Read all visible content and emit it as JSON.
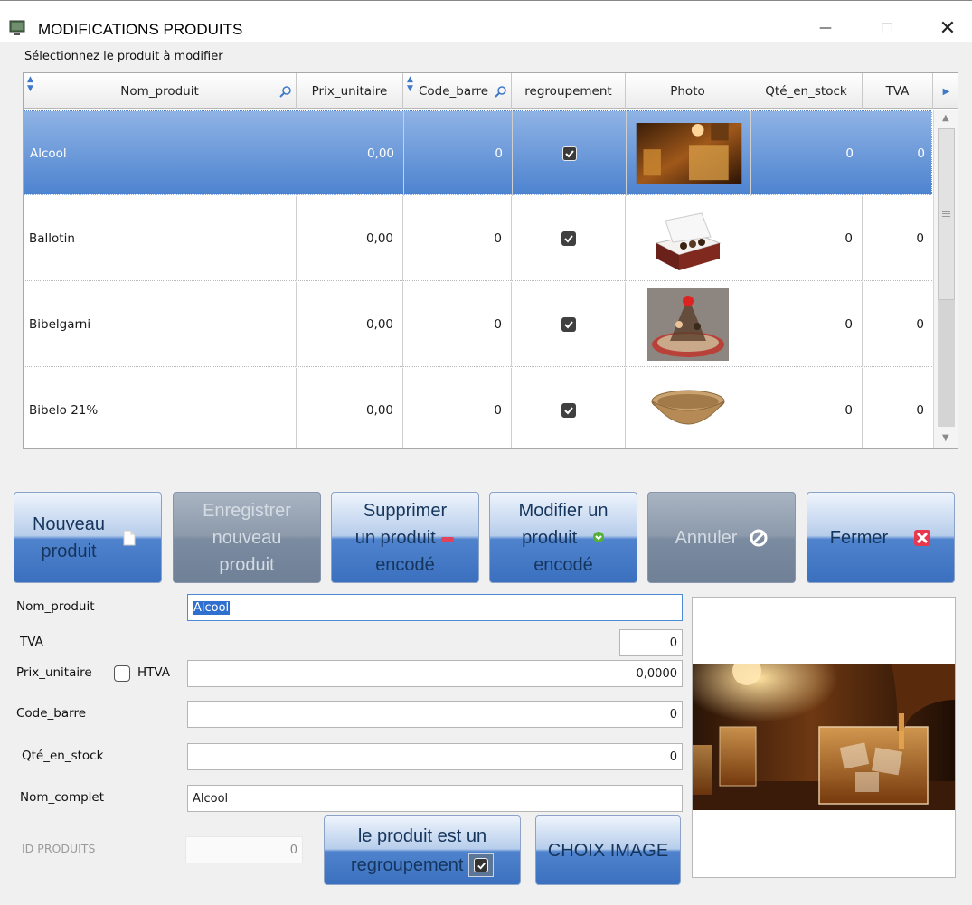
{
  "window": {
    "title": "MODIFICATIONS PRODUITS",
    "minimize": "—",
    "maximize": "☐",
    "close": "✕"
  },
  "select_label": "Sélectionnez le produit à modifier",
  "table": {
    "columns": [
      "Nom_produit",
      "Prix_unitaire",
      "Code_barre",
      "regroupement",
      "Photo",
      "Qté_en_stock",
      "TVA"
    ],
    "rows": [
      {
        "nom": "Alcool",
        "prix": "0,00",
        "code": "0",
        "regroupement": true,
        "photo": "whisky-glasses",
        "stock": "0",
        "tva": "0",
        "selected": true
      },
      {
        "nom": "Ballotin",
        "prix": "0,00",
        "code": "0",
        "regroupement": true,
        "photo": "chocolate-box",
        "stock": "0",
        "tva": "0",
        "selected": false
      },
      {
        "nom": "Bibelgarni",
        "prix": "0,00",
        "code": "0",
        "regroupement": true,
        "photo": "gift-basket",
        "stock": "0",
        "tva": "0",
        "selected": false
      },
      {
        "nom": "Bibelo 21%",
        "prix": "0,00",
        "code": "0",
        "regroupement": true,
        "photo": "wicker-basket",
        "stock": "0",
        "tva": "0",
        "selected": false
      }
    ]
  },
  "buttons": {
    "nouveau": "Nouveau produit",
    "nouveau_l1": "Nouveau",
    "nouveau_l2": "produit",
    "enregistrer_l1": "Enregistrer",
    "enregistrer_l2": "nouveau",
    "enregistrer_l3": "produit",
    "supprimer_l1": "Supprimer",
    "supprimer_l2": "un produit",
    "supprimer_l3": "encodé",
    "modifier_l1": "Modifier un",
    "modifier_l2": "produit",
    "modifier_l3": "encodé",
    "annuler": "Annuler",
    "fermer": "Fermer",
    "regroupement_l1": "le produit est un",
    "regroupement_l2": "regroupement",
    "choix_image": "CHOIX IMAGE"
  },
  "form": {
    "nom_produit_label": "Nom_produit",
    "nom_produit_value": "Alcool",
    "tva_label": "TVA",
    "tva_value": "0",
    "prix_label": "Prix_unitaire",
    "htva_label": "HTVA",
    "htva_checked": false,
    "prix_value": "0,0000",
    "code_label": "Code_barre",
    "code_value": "0",
    "stock_label": "Qté_en_stock",
    "stock_value": "0",
    "nom_complet_label": "Nom_complet",
    "nom_complet_value": "Alcool",
    "id_label": "ID PRODUITS",
    "id_value": "0",
    "regroupement_checked": true
  },
  "colors": {
    "selected_row": "#4d83cf",
    "button_blue": "#3b70bf",
    "button_disabled": "#7b8ba0"
  }
}
